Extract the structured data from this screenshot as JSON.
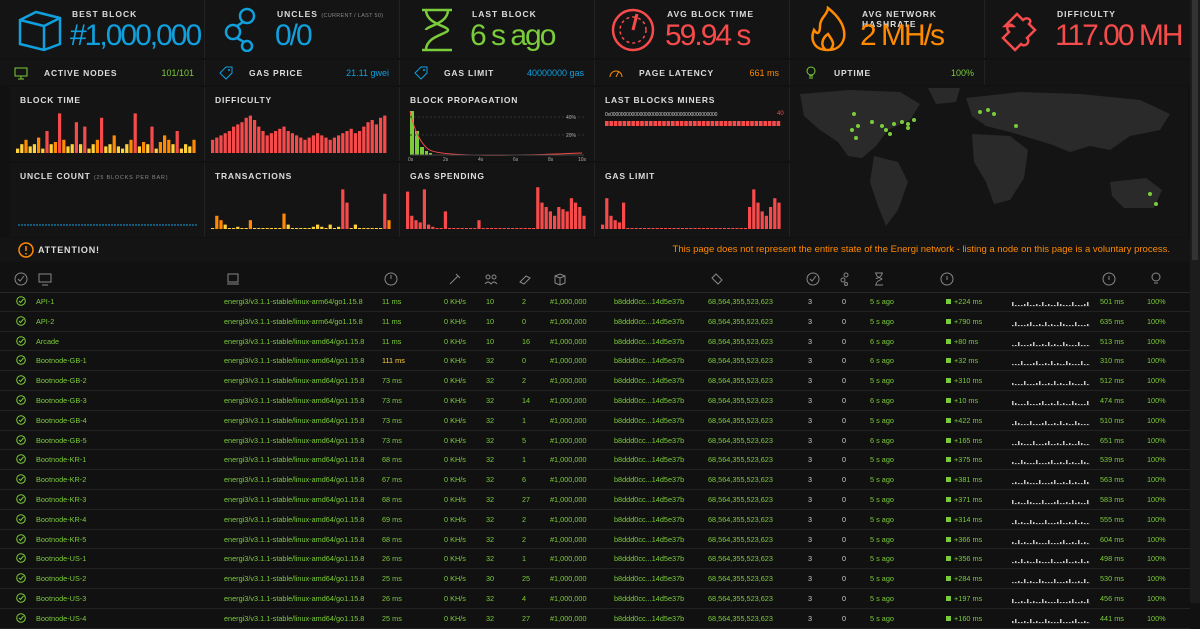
{
  "stats": [
    {
      "label": "BEST BLOCK",
      "sub": "",
      "value": "#1,000,000",
      "color": "#10a0de",
      "icon": "cube-icon"
    },
    {
      "label": "UNCLES",
      "sub": "(CURRENT / LAST 50)",
      "value": "0/0",
      "color": "#10a0de",
      "icon": "uncles-icon"
    },
    {
      "label": "LAST BLOCK",
      "sub": "",
      "value": "6 s ago",
      "color": "#7bcc3a",
      "icon": "hourglass-icon"
    },
    {
      "label": "AVG BLOCK TIME",
      "sub": "",
      "value": "59.94 s",
      "color": "#f74b4b",
      "icon": "gauge-icon"
    },
    {
      "label": "AVG NETWORK HASHRATE",
      "sub": "",
      "value": "2 MH/s",
      "color": "#ff8a00",
      "icon": "fire-icon"
    },
    {
      "label": "DIFFICULTY",
      "sub": "",
      "value": "117.00 MH",
      "color": "#f74b4b",
      "icon": "puzzle-icon"
    }
  ],
  "infobar": [
    {
      "label": "ACTIVE NODES",
      "value": "101/101",
      "color": "#7bcc3a",
      "icon": "monitor-icon"
    },
    {
      "label": "GAS PRICE",
      "value": "21.11 gwei",
      "color": "#10a0de",
      "icon": "tag-icon"
    },
    {
      "label": "GAS LIMIT",
      "value": "40000000 gas",
      "color": "#10a0de",
      "icon": "tag-icon"
    },
    {
      "label": "PAGE LATENCY",
      "value": "661 ms",
      "color": "#ff8a00",
      "icon": "speedometer-icon"
    },
    {
      "label": "UPTIME",
      "value": "100%",
      "color": "#7bcc3a",
      "icon": "bulb-icon"
    }
  ],
  "charts": {
    "block_time": "BLOCK TIME",
    "difficulty": "DIFFICULTY",
    "block_propagation": "BLOCK PROPAGATION",
    "last_blocks_miners": "LAST BLOCKS MINERS",
    "miner_address": "0x0000000000000000000000000000000000000000",
    "miner_count": "40",
    "uncle_count": "UNCLE COUNT",
    "uncle_count_sub": "(25 BLOCKS PER BAR)",
    "transactions": "TRANSACTIONS",
    "gas_spending": "GAS SPENDING",
    "gas_limit": "GAS LIMIT",
    "prop_ticks": [
      "0s",
      "2s",
      "4s",
      "6s",
      "8s",
      "10s"
    ],
    "prop_pct": [
      "40%",
      "20%"
    ]
  },
  "attention": {
    "label": "ATTENTION!",
    "message": "This page does not represent the entire state of the Energi network - listing a node on this page is a voluntary process."
  },
  "nodes": [
    {
      "name": "API-1",
      "client": "energi3/v3.1.1-stable/linux-arm64/go1.15.8",
      "latency": "11 ms",
      "hashrate": "0 KH/s",
      "peers": "10",
      "pending": "2",
      "block": "#1,000,000",
      "hash": "b8ddd0cc...14d5e37b",
      "difficulty": "68,564,355,523,623",
      "uncles": "3",
      "tx": "0",
      "last": "5 s ago",
      "prop": "+224 ms",
      "avg": "501 ms",
      "uptime": "100%"
    },
    {
      "name": "API-2",
      "client": "energi3/v3.1.1-stable/linux-arm64/go1.15.8",
      "latency": "11 ms",
      "hashrate": "0 KH/s",
      "peers": "10",
      "pending": "0",
      "block": "#1,000,000",
      "hash": "b8ddd0cc...14d5e37b",
      "difficulty": "68,564,355,523,623",
      "uncles": "3",
      "tx": "0",
      "last": "5 s ago",
      "prop": "+790 ms",
      "avg": "635 ms",
      "uptime": "100%"
    },
    {
      "name": "Arcade",
      "client": "energi3/v3.1.1-stable/linux-amd64/go1.15.8",
      "latency": "11 ms",
      "hashrate": "0 KH/s",
      "peers": "10",
      "pending": "16",
      "block": "#1,000,000",
      "hash": "b8ddd0cc...14d5e37b",
      "difficulty": "68,564,355,523,623",
      "uncles": "3",
      "tx": "0",
      "last": "6 s ago",
      "prop": "+80 ms",
      "avg": "513 ms",
      "uptime": "100%"
    },
    {
      "name": "Bootnode-GB-1",
      "client": "energi3/v3.1.1-stable/linux-amd64/go1.15.8",
      "latency": "111 ms",
      "hashrate": "0 KH/s",
      "peers": "32",
      "pending": "0",
      "block": "#1,000,000",
      "hash": "b8ddd0cc...14d5e37b",
      "difficulty": "68,564,355,523,623",
      "uncles": "3",
      "tx": "0",
      "last": "6 s ago",
      "prop": "+32 ms",
      "avg": "310 ms",
      "uptime": "100%"
    },
    {
      "name": "Bootnode-GB-2",
      "client": "energi3/v3.1.1-stable/linux-amd64/go1.15.8",
      "latency": "73 ms",
      "hashrate": "0 KH/s",
      "peers": "32",
      "pending": "2",
      "block": "#1,000,000",
      "hash": "b8ddd0cc...14d5e37b",
      "difficulty": "68,564,355,523,623",
      "uncles": "3",
      "tx": "0",
      "last": "5 s ago",
      "prop": "+310 ms",
      "avg": "512 ms",
      "uptime": "100%"
    },
    {
      "name": "Bootnode-GB-3",
      "client": "energi3/v3.1.1-stable/linux-amd64/go1.15.8",
      "latency": "73 ms",
      "hashrate": "0 KH/s",
      "peers": "32",
      "pending": "14",
      "block": "#1,000,000",
      "hash": "b8ddd0cc...14d5e37b",
      "difficulty": "68,564,355,523,623",
      "uncles": "3",
      "tx": "0",
      "last": "6 s ago",
      "prop": "+10 ms",
      "avg": "474 ms",
      "uptime": "100%"
    },
    {
      "name": "Bootnode-GB-4",
      "client": "energi3/v3.1.1-stable/linux-amd64/go1.15.8",
      "latency": "73 ms",
      "hashrate": "0 KH/s",
      "peers": "32",
      "pending": "1",
      "block": "#1,000,000",
      "hash": "b8ddd0cc...14d5e37b",
      "difficulty": "68,564,355,523,623",
      "uncles": "3",
      "tx": "0",
      "last": "5 s ago",
      "prop": "+422 ms",
      "avg": "510 ms",
      "uptime": "100%"
    },
    {
      "name": "Bootnode-GB-5",
      "client": "energi3/v3.1.1-stable/linux-amd64/go1.15.8",
      "latency": "73 ms",
      "hashrate": "0 KH/s",
      "peers": "32",
      "pending": "5",
      "block": "#1,000,000",
      "hash": "b8ddd0cc...14d5e37b",
      "difficulty": "68,564,355,523,623",
      "uncles": "3",
      "tx": "0",
      "last": "6 s ago",
      "prop": "+165 ms",
      "avg": "651 ms",
      "uptime": "100%"
    },
    {
      "name": "Bootnode-KR-1",
      "client": "energi3/v3.1.1-stable/linux-amd64/go1.15.8",
      "latency": "68 ms",
      "hashrate": "0 KH/s",
      "peers": "32",
      "pending": "1",
      "block": "#1,000,000",
      "hash": "b8ddd0cc...14d5e37b",
      "difficulty": "68,564,355,523,623",
      "uncles": "3",
      "tx": "0",
      "last": "5 s ago",
      "prop": "+375 ms",
      "avg": "539 ms",
      "uptime": "100%"
    },
    {
      "name": "Bootnode-KR-2",
      "client": "energi3/v3.1.1-stable/linux-amd64/go1.15.8",
      "latency": "67 ms",
      "hashrate": "0 KH/s",
      "peers": "32",
      "pending": "6",
      "block": "#1,000,000",
      "hash": "b8ddd0cc...14d5e37b",
      "difficulty": "68,564,355,523,623",
      "uncles": "3",
      "tx": "0",
      "last": "5 s ago",
      "prop": "+381 ms",
      "avg": "563 ms",
      "uptime": "100%"
    },
    {
      "name": "Bootnode-KR-3",
      "client": "energi3/v3.1.1-stable/linux-amd64/go1.15.8",
      "latency": "68 ms",
      "hashrate": "0 KH/s",
      "peers": "32",
      "pending": "27",
      "block": "#1,000,000",
      "hash": "b8ddd0cc...14d5e37b",
      "difficulty": "68,564,355,523,623",
      "uncles": "3",
      "tx": "0",
      "last": "5 s ago",
      "prop": "+371 ms",
      "avg": "583 ms",
      "uptime": "100%"
    },
    {
      "name": "Bootnode-KR-4",
      "client": "energi3/v3.1.1-stable/linux-amd64/go1.15.8",
      "latency": "69 ms",
      "hashrate": "0 KH/s",
      "peers": "32",
      "pending": "2",
      "block": "#1,000,000",
      "hash": "b8ddd0cc...14d5e37b",
      "difficulty": "68,564,355,523,623",
      "uncles": "3",
      "tx": "0",
      "last": "5 s ago",
      "prop": "+314 ms",
      "avg": "555 ms",
      "uptime": "100%"
    },
    {
      "name": "Bootnode-KR-5",
      "client": "energi3/v3.1.1-stable/linux-amd64/go1.15.8",
      "latency": "68 ms",
      "hashrate": "0 KH/s",
      "peers": "32",
      "pending": "2",
      "block": "#1,000,000",
      "hash": "b8ddd0cc...14d5e37b",
      "difficulty": "68,564,355,523,623",
      "uncles": "3",
      "tx": "0",
      "last": "5 s ago",
      "prop": "+366 ms",
      "avg": "604 ms",
      "uptime": "100%"
    },
    {
      "name": "Bootnode-US-1",
      "client": "energi3/v3.1.1-stable/linux-amd64/go1.15.8",
      "latency": "26 ms",
      "hashrate": "0 KH/s",
      "peers": "32",
      "pending": "1",
      "block": "#1,000,000",
      "hash": "b8ddd0cc...14d5e37b",
      "difficulty": "68,564,355,523,623",
      "uncles": "3",
      "tx": "0",
      "last": "5 s ago",
      "prop": "+356 ms",
      "avg": "498 ms",
      "uptime": "100%"
    },
    {
      "name": "Bootnode-US-2",
      "client": "energi3/v3.1.1-stable/linux-amd64/go1.15.8",
      "latency": "25 ms",
      "hashrate": "0 KH/s",
      "peers": "30",
      "pending": "25",
      "block": "#1,000,000",
      "hash": "b8ddd0cc...14d5e37b",
      "difficulty": "68,564,355,523,623",
      "uncles": "3",
      "tx": "0",
      "last": "5 s ago",
      "prop": "+284 ms",
      "avg": "530 ms",
      "uptime": "100%"
    },
    {
      "name": "Bootnode-US-3",
      "client": "energi3/v3.1.1-stable/linux-amd64/go1.15.8",
      "latency": "26 ms",
      "hashrate": "0 KH/s",
      "peers": "32",
      "pending": "4",
      "block": "#1,000,000",
      "hash": "b8ddd0cc...14d5e37b",
      "difficulty": "68,564,355,523,623",
      "uncles": "3",
      "tx": "0",
      "last": "5 s ago",
      "prop": "+197 ms",
      "avg": "456 ms",
      "uptime": "100%"
    },
    {
      "name": "Bootnode-US-4",
      "client": "energi3/v3.1.1-stable/linux-amd64/go1.15.8",
      "latency": "25 ms",
      "hashrate": "0 KH/s",
      "peers": "32",
      "pending": "27",
      "block": "#1,000,000",
      "hash": "b8ddd0cc...14d5e37b",
      "difficulty": "68,564,355,523,623",
      "uncles": "3",
      "tx": "0",
      "last": "5 s ago",
      "prop": "+160 ms",
      "avg": "441 ms",
      "uptime": "100%"
    }
  ]
}
